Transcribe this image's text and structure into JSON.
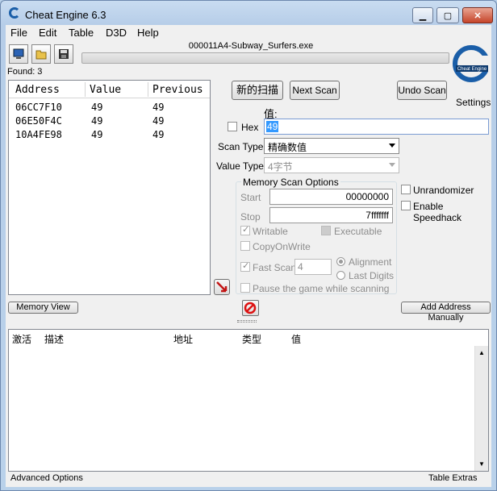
{
  "window": {
    "title": "Cheat Engine 6.3"
  },
  "menu": [
    "File",
    "Edit",
    "Table",
    "D3D",
    "Help"
  ],
  "toolbar": {
    "open_process_icon": "computer-icon",
    "open_file_icon": "folder-open-icon",
    "save_icon": "floppy-disk-icon"
  },
  "process": {
    "name": "000011A4-Subway_Surfers.exe",
    "progress": 0
  },
  "settings_label": "Settings",
  "found_label": "Found: 3",
  "results": {
    "columns": [
      "Address",
      "Value",
      "Previous"
    ],
    "rows": [
      [
        "06CC7F10",
        "49",
        "49"
      ],
      [
        "06E50F4C",
        "49",
        "49"
      ],
      [
        "10A4FE98",
        "49",
        "49"
      ]
    ]
  },
  "buttons": {
    "first_scan": "新的扫描",
    "next_scan": "Next Scan",
    "undo_scan": "Undo Scan",
    "memory_view": "Memory View",
    "add_address": "Add Address Manually"
  },
  "value_label": "值:",
  "hex_label": "Hex",
  "value_input": "49",
  "scan_type": {
    "label": "Scan Type",
    "selected": "精确数值"
  },
  "value_type": {
    "label": "Value Type",
    "selected": "4字节"
  },
  "memory_scan": {
    "title": "Memory Scan Options",
    "start_label": "Start",
    "start_value": "00000000",
    "stop_label": "Stop",
    "stop_value": "7fffffff",
    "writable": "Writable",
    "executable": "Executable",
    "copy_on_write": "CopyOnWrite",
    "fast_scan": "Fast Scan",
    "fast_scan_value": "4",
    "alignment": "Alignment",
    "last_digits": "Last Digits",
    "pause": "Pause the game while scanning"
  },
  "unrandomizer": "Unrandomizer",
  "speedhack": "Enable Speedhack",
  "cheat_table": {
    "columns": [
      "激活",
      "描述",
      "地址",
      "类型",
      "值"
    ]
  },
  "status": {
    "advanced": "Advanced Options",
    "extras": "Table Extras"
  },
  "colors": {
    "title_bg": "#b9d1ea",
    "selection": "#3399ff",
    "accent": "#1a5ea8"
  }
}
